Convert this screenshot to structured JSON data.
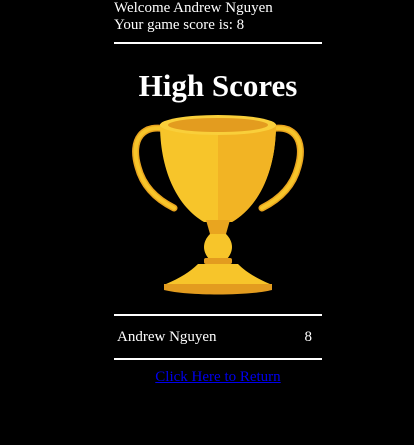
{
  "header": {
    "welcome": "Welcome Andrew Nguyen",
    "score_text": "Your game score is: 8"
  },
  "main": {
    "title": "High Scores",
    "trophy_icon": "trophy-icon",
    "scores": [
      {
        "name": "Andrew Nguyen",
        "score": "8"
      }
    ],
    "return_link": "Click Here to Return"
  },
  "colors": {
    "background": "#000000",
    "text": "#ffffff",
    "link": "#0000ee",
    "trophy_gold": "#f7c52a",
    "trophy_dark": "#e39c1f"
  }
}
